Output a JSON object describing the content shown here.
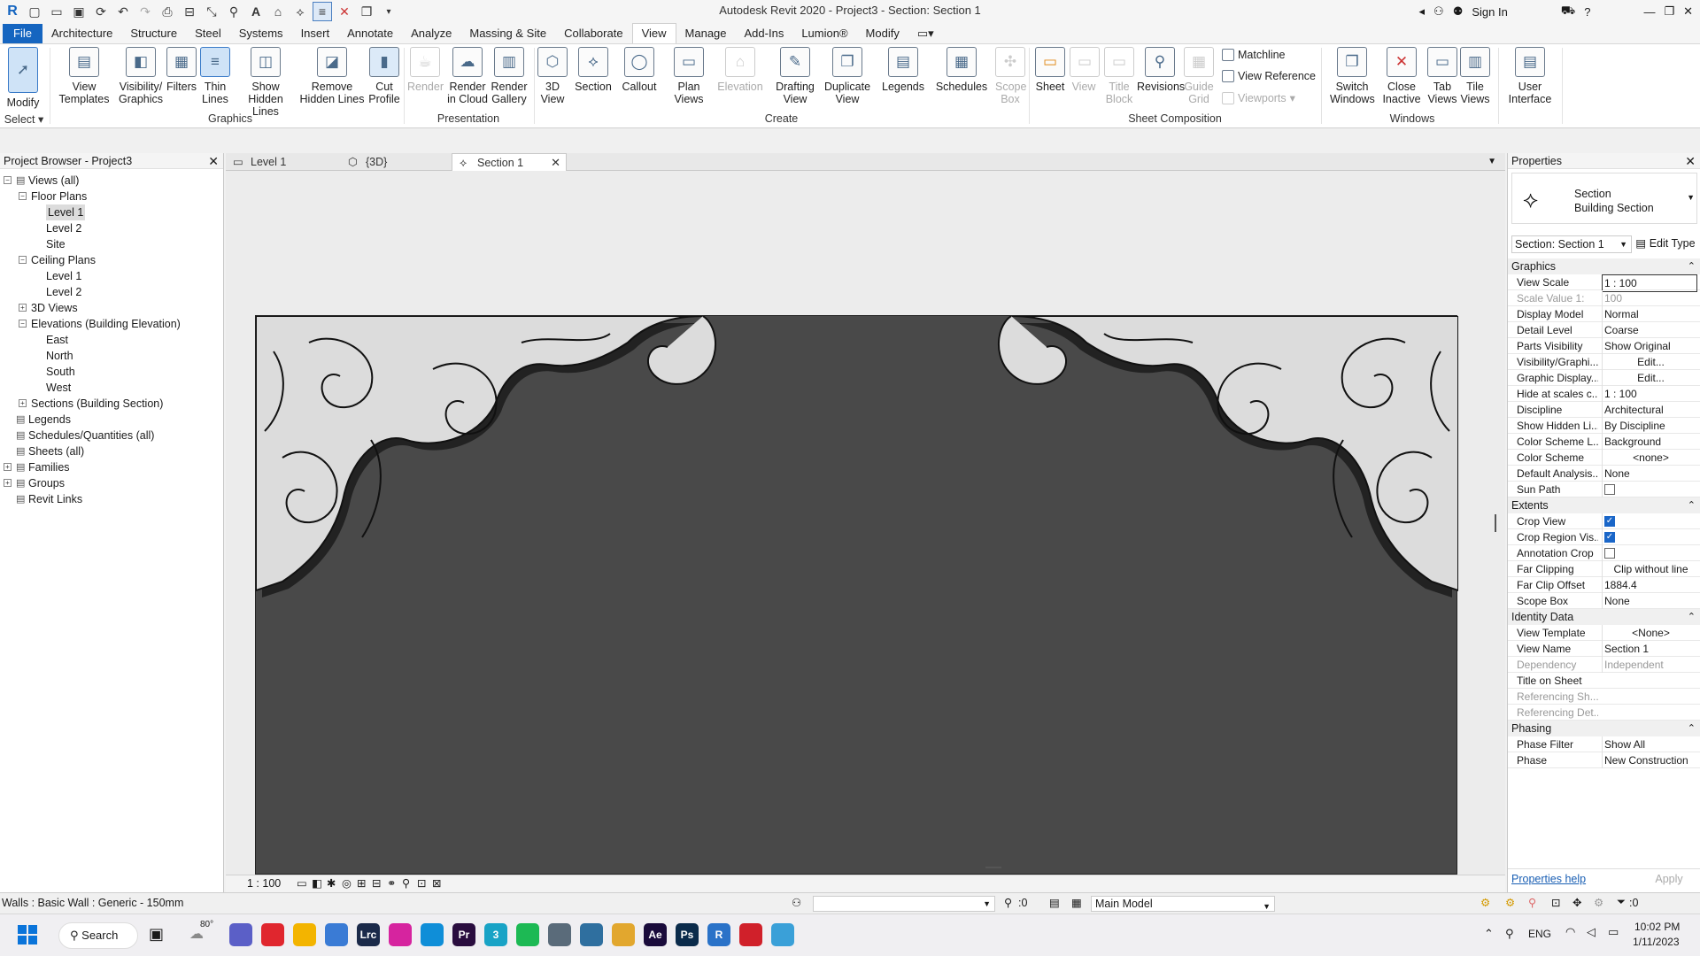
{
  "window": {
    "title": "Autodesk Revit 2020 - Project3 - Section: Section 1",
    "sign_in": "Sign In"
  },
  "ribbon_tabs": [
    "File",
    "Architecture",
    "Structure",
    "Steel",
    "Systems",
    "Insert",
    "Annotate",
    "Analyze",
    "Massing & Site",
    "Collaborate",
    "View",
    "Manage",
    "Add-Ins",
    "Lumion®",
    "Modify"
  ],
  "active_tab": "View",
  "ribbon": {
    "modify": "Modify",
    "select": "Select",
    "graphics": {
      "label": "Graphics",
      "view_templates": [
        "View",
        "Templates"
      ],
      "visibility_graphics": [
        "Visibility/",
        "Graphics"
      ],
      "filters": "Filters",
      "thin_lines": [
        "Thin",
        "Lines"
      ],
      "show_hidden_lines": [
        "Show",
        "Hidden Lines"
      ],
      "remove_hidden_lines": [
        "Remove",
        "Hidden Lines"
      ],
      "cut_profile": [
        "Cut",
        "Profile"
      ]
    },
    "presentation": {
      "label": "Presentation",
      "render": "Render",
      "render_cloud": [
        "Render",
        "in Cloud"
      ],
      "render_gallery": [
        "Render",
        "Gallery"
      ]
    },
    "create": {
      "label": "Create",
      "view_3d": [
        "3D",
        "View"
      ],
      "section": "Section",
      "callout": "Callout",
      "plan_views": [
        "Plan",
        "Views"
      ],
      "elevation": "Elevation",
      "drafting_view": [
        "Drafting",
        "View"
      ],
      "duplicate_view": [
        "Duplicate",
        "View"
      ],
      "legends": "Legends",
      "schedules": "Schedules",
      "scope_box": [
        "Scope",
        "Box"
      ]
    },
    "sheet_composition": {
      "label": "Sheet Composition",
      "sheet": "Sheet",
      "view": "View",
      "title_block": [
        "Title",
        "Block"
      ],
      "revisions": "Revisions",
      "guide_grid": [
        "Guide",
        "Grid"
      ],
      "matchline": "Matchline",
      "view_reference": "View  Reference",
      "viewports": "Viewports"
    },
    "windows": {
      "label": "Windows",
      "switch_windows": [
        "Switch",
        "Windows"
      ],
      "close_inactive": [
        "Close",
        "Inactive"
      ],
      "tab_views": [
        "Tab",
        "Views"
      ],
      "tile_views": [
        "Tile",
        "Views"
      ]
    },
    "user_interface": [
      "User",
      "Interface"
    ]
  },
  "project_browser": {
    "title": "Project Browser - Project3",
    "nodes": [
      {
        "label": "Views (all)",
        "x": 1,
        "y": 0
      },
      {
        "label": "Floor Plans",
        "x": 2,
        "y": 1
      },
      {
        "label": "Level 1",
        "x": 3,
        "y": 2,
        "selected": true
      },
      {
        "label": "Level 2",
        "x": 3,
        "y": 3
      },
      {
        "label": "Site",
        "x": 3,
        "y": 4
      },
      {
        "label": "Ceiling Plans",
        "x": 2,
        "y": 5
      },
      {
        "label": "Level 1",
        "x": 3,
        "y": 6
      },
      {
        "label": "Level 2",
        "x": 3,
        "y": 7
      },
      {
        "label": "3D Views",
        "x": 2,
        "y": 8
      },
      {
        "label": "Elevations (Building Elevation)",
        "x": 2,
        "y": 9
      },
      {
        "label": "East",
        "x": 3,
        "y": 10
      },
      {
        "label": "North",
        "x": 3,
        "y": 11
      },
      {
        "label": "South",
        "x": 3,
        "y": 12
      },
      {
        "label": "West",
        "x": 3,
        "y": 13
      },
      {
        "label": "Sections (Building Section)",
        "x": 2,
        "y": 14
      },
      {
        "label": "Legends",
        "x": 1,
        "y": 15
      },
      {
        "label": "Schedules/Quantities (all)",
        "x": 1,
        "y": 16
      },
      {
        "label": "Sheets (all)",
        "x": 1,
        "y": 17
      },
      {
        "label": "Families",
        "x": 1,
        "y": 18
      },
      {
        "label": "Groups",
        "x": 1,
        "y": 19
      },
      {
        "label": "Revit Links",
        "x": 1,
        "y": 20
      }
    ]
  },
  "doc_tabs": [
    "Level 1",
    "{3D}",
    "Section 1"
  ],
  "active_doc_tab": "Section 1",
  "view_bar": {
    "scale": "1 : 100"
  },
  "properties": {
    "title": "Properties",
    "type_name": "Section",
    "type_sub": "Building Section",
    "selector": "Section: Section 1",
    "edit_type": "Edit Type",
    "sections": [
      {
        "name": "Graphics",
        "rows": [
          {
            "k": "View Scale",
            "v": "1 : 100"
          },
          {
            "k": "Scale Value    1:",
            "v": "100",
            "dim": true
          },
          {
            "k": "Display Model",
            "v": "Normal"
          },
          {
            "k": "Detail Level",
            "v": "Coarse"
          },
          {
            "k": "Parts Visibility",
            "v": "Show Original"
          },
          {
            "k": "Visibility/Graphi...",
            "v": "Edit...",
            "btn": true
          },
          {
            "k": "Graphic Display...",
            "v": "Edit...",
            "btn": true
          },
          {
            "k": "Hide at scales c...",
            "v": "1 : 100"
          },
          {
            "k": "Discipline",
            "v": "Architectural"
          },
          {
            "k": "Show Hidden Li...",
            "v": "By Discipline"
          },
          {
            "k": "Color Scheme L...",
            "v": "Background"
          },
          {
            "k": "Color Scheme",
            "v": "<none>",
            "btn": true
          },
          {
            "k": "Default Analysis...",
            "v": "None"
          },
          {
            "k": "Sun Path",
            "v": "",
            "check": false
          }
        ]
      },
      {
        "name": "Extents",
        "rows": [
          {
            "k": "Crop View",
            "v": "",
            "check": true
          },
          {
            "k": "Crop Region Vis...",
            "v": "",
            "check": true
          },
          {
            "k": "Annotation Crop",
            "v": "",
            "check": false
          },
          {
            "k": "Far Clipping",
            "v": "Clip without line",
            "btn": true
          },
          {
            "k": "Far Clip Offset",
            "v": "1884.4"
          },
          {
            "k": "Scope Box",
            "v": "None"
          }
        ]
      },
      {
        "name": "Identity Data",
        "rows": [
          {
            "k": "View Template",
            "v": "<None>",
            "btn": true
          },
          {
            "k": "View Name",
            "v": "Section 1"
          },
          {
            "k": "Dependency",
            "v": "Independent",
            "dim": true
          },
          {
            "k": "Title on Sheet",
            "v": ""
          },
          {
            "k": "Referencing Sh...",
            "v": "",
            "dim": true
          },
          {
            "k": "Referencing Det...",
            "v": "",
            "dim": true
          }
        ]
      },
      {
        "name": "Phasing",
        "rows": [
          {
            "k": "Phase Filter",
            "v": "Show All"
          },
          {
            "k": "Phase",
            "v": "New Construction"
          }
        ]
      }
    ],
    "help": "Properties help",
    "apply": "Apply"
  },
  "status_bar": {
    "left": "Walls : Basic Wall : Generic - 150mm",
    "count": ":0",
    "model": "Main Model",
    "filter_count": ":0"
  },
  "taskbar": {
    "search": "Search",
    "weather": "80°",
    "lang": "ENG",
    "time": "10:02 PM",
    "date": "1/11/2023",
    "apps": [
      {
        "name": "teams",
        "color": "#5b5fc7"
      },
      {
        "name": "opera",
        "color": "#e0262e"
      },
      {
        "name": "explorer",
        "color": "#f3b400"
      },
      {
        "name": "photos",
        "color": "#3a7bd5"
      },
      {
        "name": "lightroom",
        "color": "#1b2a4a",
        "label": "Lrc"
      },
      {
        "name": "instagram",
        "color": "#d6249f"
      },
      {
        "name": "edge",
        "color": "#0f8ed8"
      },
      {
        "name": "premiere",
        "color": "#2a0d3f",
        "label": "Pr"
      },
      {
        "name": "3dsmax",
        "color": "#19a3c6",
        "label": "3"
      },
      {
        "name": "spotify",
        "color": "#1db954"
      },
      {
        "name": "app-grey",
        "color": "#5a6b7a"
      },
      {
        "name": "app-blue",
        "color": "#2f6f9f"
      },
      {
        "name": "app-yellow",
        "color": "#e2a72e"
      },
      {
        "name": "after-effects",
        "color": "#1a0b3b",
        "label": "Ae"
      },
      {
        "name": "photoshop",
        "color": "#0b2b4b",
        "label": "Ps"
      },
      {
        "name": "revit",
        "color": "#2a72c8",
        "label": "R"
      },
      {
        "name": "acrobat",
        "color": "#d0202a"
      },
      {
        "name": "app-globe",
        "color": "#3aa0d8"
      }
    ]
  }
}
